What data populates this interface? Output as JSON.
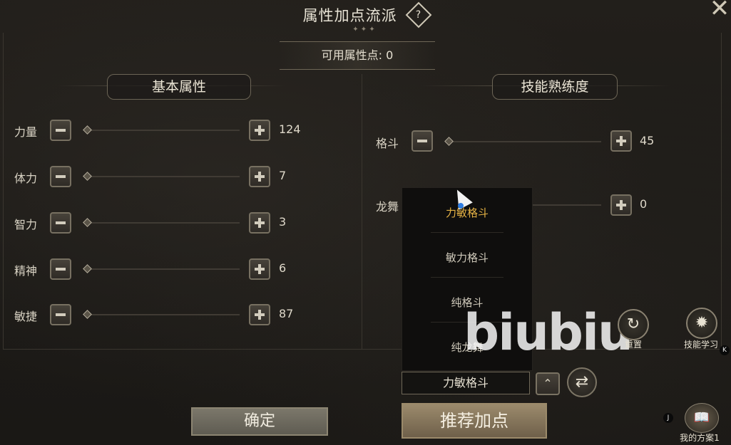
{
  "header": {
    "title": "属性加点流派",
    "help_symbol": "?",
    "close_symbol": "✕"
  },
  "points": {
    "text": "可用属性点: 0"
  },
  "basic": {
    "title": "基本属性",
    "rows": [
      {
        "label": "力量",
        "value": "124"
      },
      {
        "label": "体力",
        "value": "7"
      },
      {
        "label": "智力",
        "value": "3"
      },
      {
        "label": "精神",
        "value": "6"
      },
      {
        "label": "敏捷",
        "value": "87"
      }
    ]
  },
  "skills": {
    "title": "技能熟练度",
    "rows": [
      {
        "label": "格斗",
        "value": "45"
      },
      {
        "label": "龙舞",
        "value": "0"
      }
    ]
  },
  "dropdown": {
    "options": [
      "力敏格斗",
      "敏力格斗",
      "纯格斗",
      "纯龙舞"
    ],
    "selected_index": 0
  },
  "preset": {
    "current": "力敏格斗"
  },
  "actions": {
    "reset_label": "重置",
    "learn_label": "技能学习",
    "my_plan_label": "我的方案1",
    "confirm_label": "确定",
    "recommend_label": "推荐加点"
  },
  "hotkeys": {
    "learn": "K",
    "plan": "J"
  },
  "watermark": "biubiu"
}
